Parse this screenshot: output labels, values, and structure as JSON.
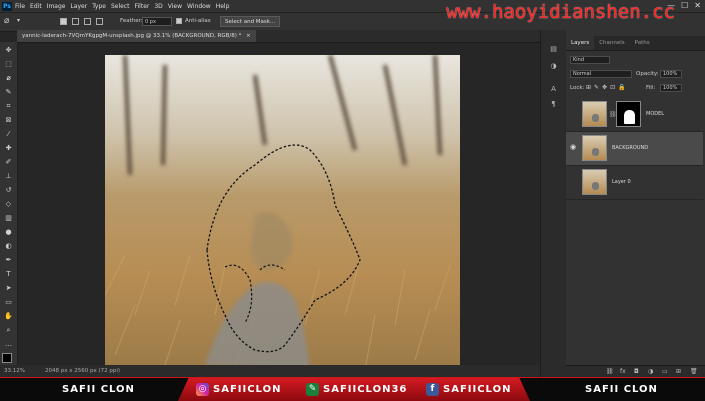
{
  "menu": [
    "File",
    "Edit",
    "Image",
    "Layer",
    "Type",
    "Select",
    "Filter",
    "3D",
    "View",
    "Window",
    "Help"
  ],
  "watermark": "www.haoyidianshen.cc",
  "options": {
    "feather_label": "Feather:",
    "feather_value": "0 px",
    "antialias_label": "Anti-alias",
    "select_mask_label": "Select and Mask..."
  },
  "document": {
    "tab_title": "yannic-laderach-7VQmYKgpgM-unsplash.jpg @ 33.1% (BACKGROUND, RGB/8) *"
  },
  "status": {
    "zoom": "33.12%",
    "doc_size": "2048 px x 2560 px (72 ppi)"
  },
  "layers_panel": {
    "tabs": [
      "Layers",
      "Channels",
      "Paths"
    ],
    "kind": "Kind",
    "blend": "Normal",
    "opacity_label": "Opacity:",
    "opacity_value": "100%",
    "lock_label": "Lock:",
    "fill_label": "Fill:",
    "fill_value": "100%",
    "layers": [
      {
        "name": "MODEL",
        "visible": false
      },
      {
        "name": "BACKGROUND",
        "visible": true
      },
      {
        "name": "Layer 0",
        "visible": false
      }
    ]
  },
  "banner": {
    "left": "SAFII CLON",
    "instagram": "SAFIICLON",
    "other": "SAFIICLON36",
    "facebook": "SAFIICLON",
    "right": "SAFII CLON"
  },
  "colors": {
    "ui_dark": "#262626",
    "panel": "#323232",
    "accent_red": "#d41a22",
    "watermark": "#ff1f1f"
  }
}
